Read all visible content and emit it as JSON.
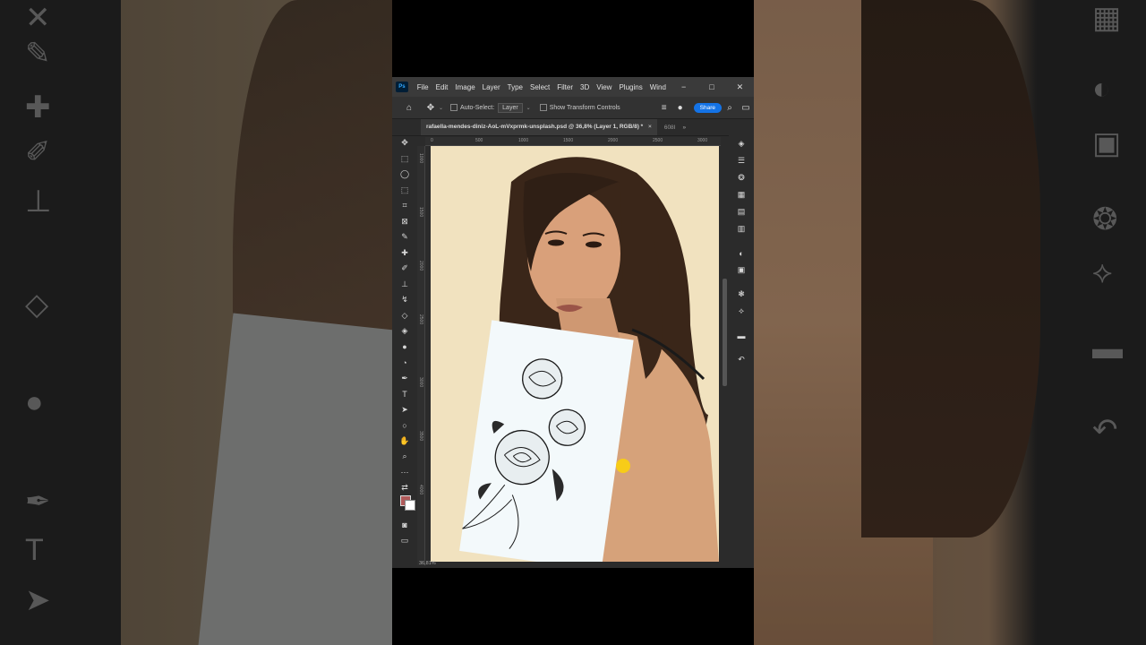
{
  "window": {
    "app_logo": "Ps",
    "minimize": "−",
    "maximize": "□",
    "close": "✕"
  },
  "menu": [
    "File",
    "Edit",
    "Image",
    "Layer",
    "Type",
    "Select",
    "Filter",
    "3D",
    "View",
    "Plugins",
    "Wind"
  ],
  "options_bar": {
    "auto_select_label": "Auto-Select:",
    "auto_select_value": "Layer",
    "transform_controls_label": "Show Transform Controls",
    "share_label": "Share"
  },
  "document_tab": {
    "title": "rafaella-mendes-diniz-AoL-mVxprmk-unsplash.psd @ 36,8% (Layer 1, RGB/8) *",
    "close": "×",
    "second_tab": "608I",
    "overflow": "»"
  },
  "ruler_top": [
    "0",
    "500",
    "1000",
    "1500",
    "2000",
    "2500",
    "3000"
  ],
  "ruler_left": [
    "1000",
    "1500",
    "2000",
    "2500",
    "3000",
    "3500",
    "4000"
  ],
  "status": {
    "zoom": "36,81%"
  },
  "tools": [
    "move-tool",
    "marquee-tool",
    "lasso-tool",
    "object-select-tool",
    "crop-tool",
    "frame-tool",
    "eyedropper-tool",
    "healing-brush-tool",
    "brush-tool",
    "clone-stamp-tool",
    "history-brush-tool",
    "eraser-tool",
    "paint-bucket-tool",
    "blur-tool",
    "dodge-tool",
    "pen-tool",
    "type-tool",
    "path-select-tool",
    "shape-tool",
    "hand-tool",
    "zoom-tool",
    "more-tools"
  ],
  "panels": [
    "layers-icon",
    "adjustments-icon",
    "properties-icon",
    "channels-icon",
    "swatches-icon",
    "gradients-icon",
    "color-icon",
    "libraries-icon",
    "styles-icon",
    "paths-icon",
    "comments-icon",
    "history-icon"
  ],
  "colors": {
    "foreground": "#b05a5a",
    "background": "#ffffff",
    "accent": "#1473e6"
  }
}
